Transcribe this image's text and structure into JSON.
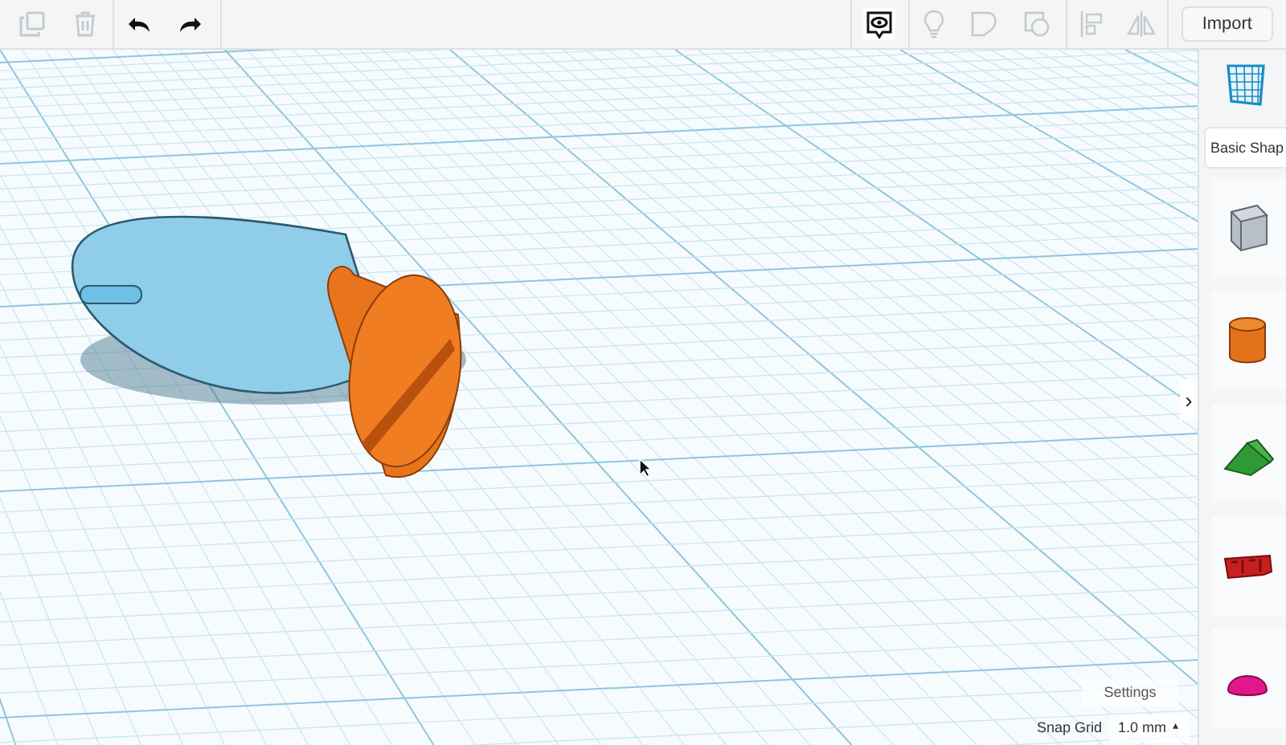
{
  "toolbar_left": [
    {
      "kind": "duplicate",
      "disabled": true
    },
    {
      "kind": "delete",
      "disabled": true
    },
    {
      "kind": "undo",
      "disabled": false
    },
    {
      "kind": "redo",
      "disabled": false
    }
  ],
  "toolbar_right": [
    {
      "kind": "view",
      "disabled": false
    },
    {
      "kind": "bulb",
      "disabled": true
    },
    {
      "kind": "group",
      "disabled": true
    },
    {
      "kind": "ungroup",
      "disabled": true
    },
    {
      "kind": "align",
      "disabled": true
    },
    {
      "kind": "mirror",
      "disabled": true
    }
  ],
  "import_button": "Import",
  "sidebar": {
    "category": "Basic Shap",
    "collapse": "›",
    "shapes": [
      {
        "kind": "box"
      },
      {
        "kind": "cylinder"
      },
      {
        "kind": "roof"
      },
      {
        "kind": "text"
      },
      {
        "kind": "half-sphere"
      }
    ]
  },
  "settings_button": "Settings",
  "snap_grid": {
    "label": "Snap Grid",
    "value": "1.0 mm",
    "caret": "▴"
  }
}
